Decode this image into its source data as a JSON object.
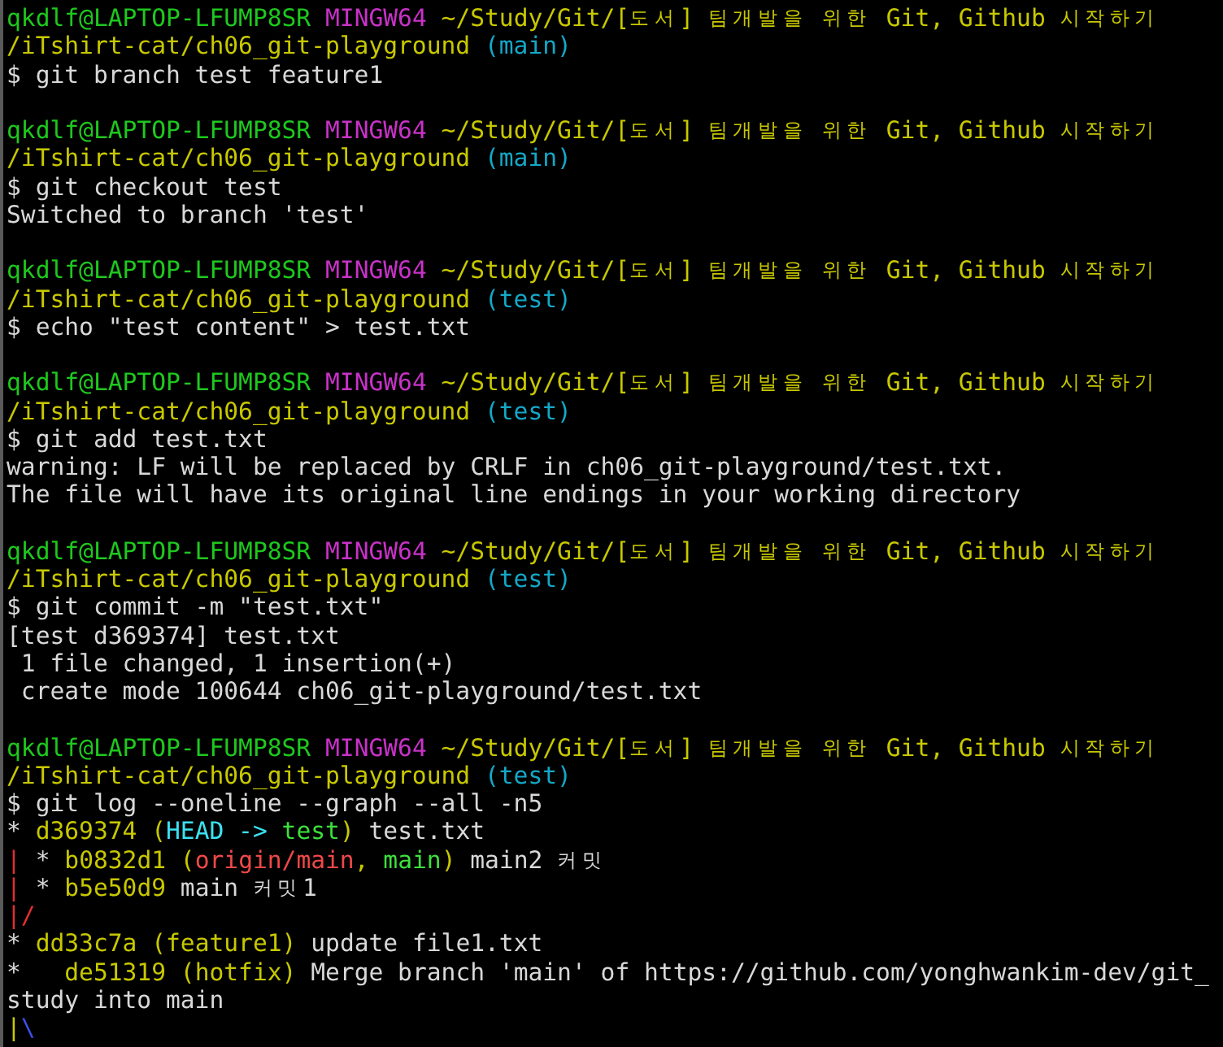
{
  "terminal": {
    "lines": [
      {
        "segments": [
          {
            "text": "qkdlf@LAPTOP-LFUMP8SR ",
            "color": "#1ec81e"
          },
          {
            "text": "MINGW64 ",
            "color": "#c832c8"
          },
          {
            "text": "~/Study/Git/[도서] 팀개발을 위한 Git, Github 시작하기",
            "color": "#c8c800"
          }
        ]
      },
      {
        "segments": [
          {
            "text": "/iTshirt-cat/ch06_git-playground ",
            "color": "#c8c800"
          },
          {
            "text": "(main)",
            "color": "#14a8c8"
          }
        ]
      },
      {
        "segments": [
          {
            "text": "$ git branch test feature1",
            "color": "#d8d8d8"
          }
        ]
      },
      {
        "gap_before": true,
        "segments": [
          {
            "text": "qkdlf@LAPTOP-LFUMP8SR ",
            "color": "#1ec81e"
          },
          {
            "text": "MINGW64 ",
            "color": "#c832c8"
          },
          {
            "text": "~/Study/Git/[도서] 팀개발을 위한 Git, Github 시작하기",
            "color": "#c8c800"
          }
        ]
      },
      {
        "segments": [
          {
            "text": "/iTshirt-cat/ch06_git-playground ",
            "color": "#c8c800"
          },
          {
            "text": "(main)",
            "color": "#14a8c8"
          }
        ]
      },
      {
        "segments": [
          {
            "text": "$ git checkout test",
            "color": "#d8d8d8"
          }
        ]
      },
      {
        "segments": [
          {
            "text": "Switched to branch 'test'",
            "color": "#d8d8d8"
          }
        ]
      },
      {
        "gap_before": true,
        "segments": [
          {
            "text": "qkdlf@LAPTOP-LFUMP8SR ",
            "color": "#1ec81e"
          },
          {
            "text": "MINGW64 ",
            "color": "#c832c8"
          },
          {
            "text": "~/Study/Git/[도서] 팀개발을 위한 Git, Github 시작하기",
            "color": "#c8c800"
          }
        ]
      },
      {
        "segments": [
          {
            "text": "/iTshirt-cat/ch06_git-playground ",
            "color": "#c8c800"
          },
          {
            "text": "(test)",
            "color": "#14a8c8"
          }
        ]
      },
      {
        "segments": [
          {
            "text": "$ echo \"test content\" > test.txt",
            "color": "#d8d8d8"
          }
        ]
      },
      {
        "gap_before": true,
        "segments": [
          {
            "text": "qkdlf@LAPTOP-LFUMP8SR ",
            "color": "#1ec81e"
          },
          {
            "text": "MINGW64 ",
            "color": "#c832c8"
          },
          {
            "text": "~/Study/Git/[도서] 팀개발을 위한 Git, Github 시작하기",
            "color": "#c8c800"
          }
        ]
      },
      {
        "segments": [
          {
            "text": "/iTshirt-cat/ch06_git-playground ",
            "color": "#c8c800"
          },
          {
            "text": "(test)",
            "color": "#14a8c8"
          }
        ]
      },
      {
        "segments": [
          {
            "text": "$ git add test.txt",
            "color": "#d8d8d8"
          }
        ]
      },
      {
        "segments": [
          {
            "text": "warning: LF will be replaced by CRLF in ch06_git-playground/test.txt.",
            "color": "#d8d8d8"
          }
        ]
      },
      {
        "segments": [
          {
            "text": "The file will have its original line endings in your working directory",
            "color": "#d8d8d8"
          }
        ]
      },
      {
        "gap_before": true,
        "segments": [
          {
            "text": "qkdlf@LAPTOP-LFUMP8SR ",
            "color": "#1ec81e"
          },
          {
            "text": "MINGW64 ",
            "color": "#c832c8"
          },
          {
            "text": "~/Study/Git/[도서] 팀개발을 위한 Git, Github 시작하기",
            "color": "#c8c800"
          }
        ]
      },
      {
        "segments": [
          {
            "text": "/iTshirt-cat/ch06_git-playground ",
            "color": "#c8c800"
          },
          {
            "text": "(test)",
            "color": "#14a8c8"
          }
        ]
      },
      {
        "segments": [
          {
            "text": "$ git commit -m \"test.txt\"",
            "color": "#d8d8d8"
          }
        ]
      },
      {
        "segments": [
          {
            "text": "[test d369374] test.txt",
            "color": "#d8d8d8"
          }
        ]
      },
      {
        "segments": [
          {
            "text": " 1 file changed, 1 insertion(+)",
            "color": "#d8d8d8"
          }
        ]
      },
      {
        "segments": [
          {
            "text": " create mode 100644 ch06_git-playground/test.txt",
            "color": "#d8d8d8"
          }
        ]
      },
      {
        "gap_before": true,
        "segments": [
          {
            "text": "qkdlf@LAPTOP-LFUMP8SR ",
            "color": "#1ec81e"
          },
          {
            "text": "MINGW64 ",
            "color": "#c832c8"
          },
          {
            "text": "~/Study/Git/[도서] 팀개발을 위한 Git, Github 시작하기",
            "color": "#c8c800"
          }
        ]
      },
      {
        "segments": [
          {
            "text": "/iTshirt-cat/ch06_git-playground ",
            "color": "#c8c800"
          },
          {
            "text": "(test)",
            "color": "#14a8c8"
          }
        ]
      },
      {
        "segments": [
          {
            "text": "$ git log --oneline --graph --all -n5",
            "color": "#d8d8d8"
          }
        ]
      },
      {
        "segments": [
          {
            "text": "* ",
            "color": "#d8d8d8"
          },
          {
            "text": "d369374 (",
            "color": "#c8c800"
          },
          {
            "text": "HEAD -> ",
            "color": "#3ce0f0"
          },
          {
            "text": "test",
            "color": "#3ce03c"
          },
          {
            "text": ")",
            "color": "#c8c800"
          },
          {
            "text": " test.txt",
            "color": "#d8d8d8"
          }
        ]
      },
      {
        "segments": [
          {
            "text": "| ",
            "color": "#e03030"
          },
          {
            "text": "* ",
            "color": "#d8d8d8"
          },
          {
            "text": "b0832d1 (",
            "color": "#c8c800"
          },
          {
            "text": "origin/main",
            "color": "#f04848"
          },
          {
            "text": ", ",
            "color": "#c8c800"
          },
          {
            "text": "main",
            "color": "#3ce03c"
          },
          {
            "text": ")",
            "color": "#c8c800"
          },
          {
            "text": " main2 커밋",
            "color": "#d8d8d8"
          }
        ]
      },
      {
        "segments": [
          {
            "text": "| ",
            "color": "#e03030"
          },
          {
            "text": "* ",
            "color": "#d8d8d8"
          },
          {
            "text": "b5e50d9",
            "color": "#c8c800"
          },
          {
            "text": " main 커밋1",
            "color": "#d8d8d8"
          }
        ]
      },
      {
        "segments": [
          {
            "text": "|/",
            "color": "#e03030"
          }
        ]
      },
      {
        "segments": [
          {
            "text": "* ",
            "color": "#d8d8d8"
          },
          {
            "text": "dd33c7a (",
            "color": "#c8c800"
          },
          {
            "text": "feature1",
            "color": "#c8c800"
          },
          {
            "text": ")",
            "color": "#c8c800"
          },
          {
            "text": " update file1.txt",
            "color": "#d8d8d8"
          }
        ]
      },
      {
        "segments": [
          {
            "text": "*   ",
            "color": "#d8d8d8"
          },
          {
            "text": "de51319 (",
            "color": "#c8c800"
          },
          {
            "text": "hotfix",
            "color": "#c8c800"
          },
          {
            "text": ")",
            "color": "#c8c800"
          },
          {
            "text": " Merge branch 'main' of https://github.com/yonghwankim-dev/git_",
            "color": "#d8d8d8"
          }
        ]
      },
      {
        "segments": [
          {
            "text": "study into main",
            "color": "#d8d8d8"
          }
        ]
      },
      {
        "segments": [
          {
            "text": "|",
            "color": "#c8c800"
          },
          {
            "text": "\\",
            "color": "#3c50e8"
          }
        ]
      }
    ]
  }
}
